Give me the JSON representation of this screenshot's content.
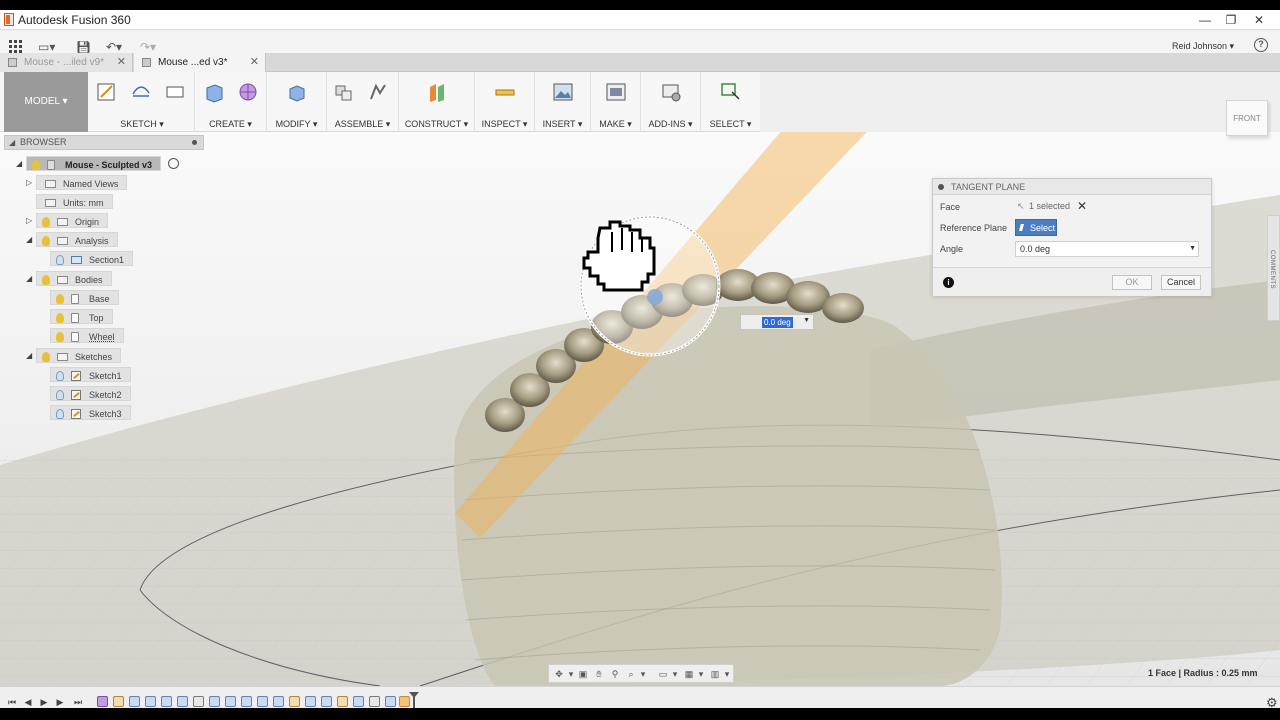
{
  "window": {
    "title": "Autodesk Fusion 360",
    "controls": [
      "—",
      "❐",
      "✕"
    ]
  },
  "quick_access": {
    "user": "Reid Johnson ▾"
  },
  "tabs": [
    {
      "label": "Mouse - ...iled v9*",
      "active": false
    },
    {
      "label": "Mouse ...ed v3*",
      "active": true
    }
  ],
  "toolbar": {
    "workspace": "MODEL ▾",
    "groups": [
      "SKETCH ▾",
      "CREATE ▾",
      "MODIFY ▾",
      "ASSEMBLE ▾",
      "CONSTRUCT ▾",
      "INSPECT ▾",
      "INSERT ▾",
      "MAKE ▾",
      "ADD-INS ▾",
      "SELECT ▾"
    ]
  },
  "browser": {
    "title": "BROWSER",
    "root": "Mouse - Sculpted v3",
    "named_views": "Named Views",
    "units": "Units: mm",
    "origin": "Origin",
    "analysis": "Analysis",
    "section1": "Section1",
    "bodies": "Bodies",
    "base": "Base",
    "top": "Top",
    "wheel": "Wheel",
    "sketches": "Sketches",
    "sketch1": "Sketch1",
    "sketch2": "Sketch2",
    "sketch3": "Sketch3"
  },
  "viewcube": {
    "label": "FRONT"
  },
  "dialog": {
    "title": "TANGENT PLANE",
    "face_label": "Face",
    "face_value": "1 selected",
    "ref_label": "Reference Plane",
    "ref_value": "Select",
    "angle_label": "Angle",
    "angle_value": "0.0 deg",
    "ok": "OK",
    "cancel": "Cancel"
  },
  "comments_tab": "COMMENTS",
  "canvas_input": {
    "value": "0.0 deg"
  },
  "status": "1 Face | Radius : 0.25 mm",
  "colors": {
    "plane": "#f3b04b",
    "selection": "#2f6ad3",
    "select_button": "#4a7ec1",
    "model_button": "#9a9a9a"
  }
}
